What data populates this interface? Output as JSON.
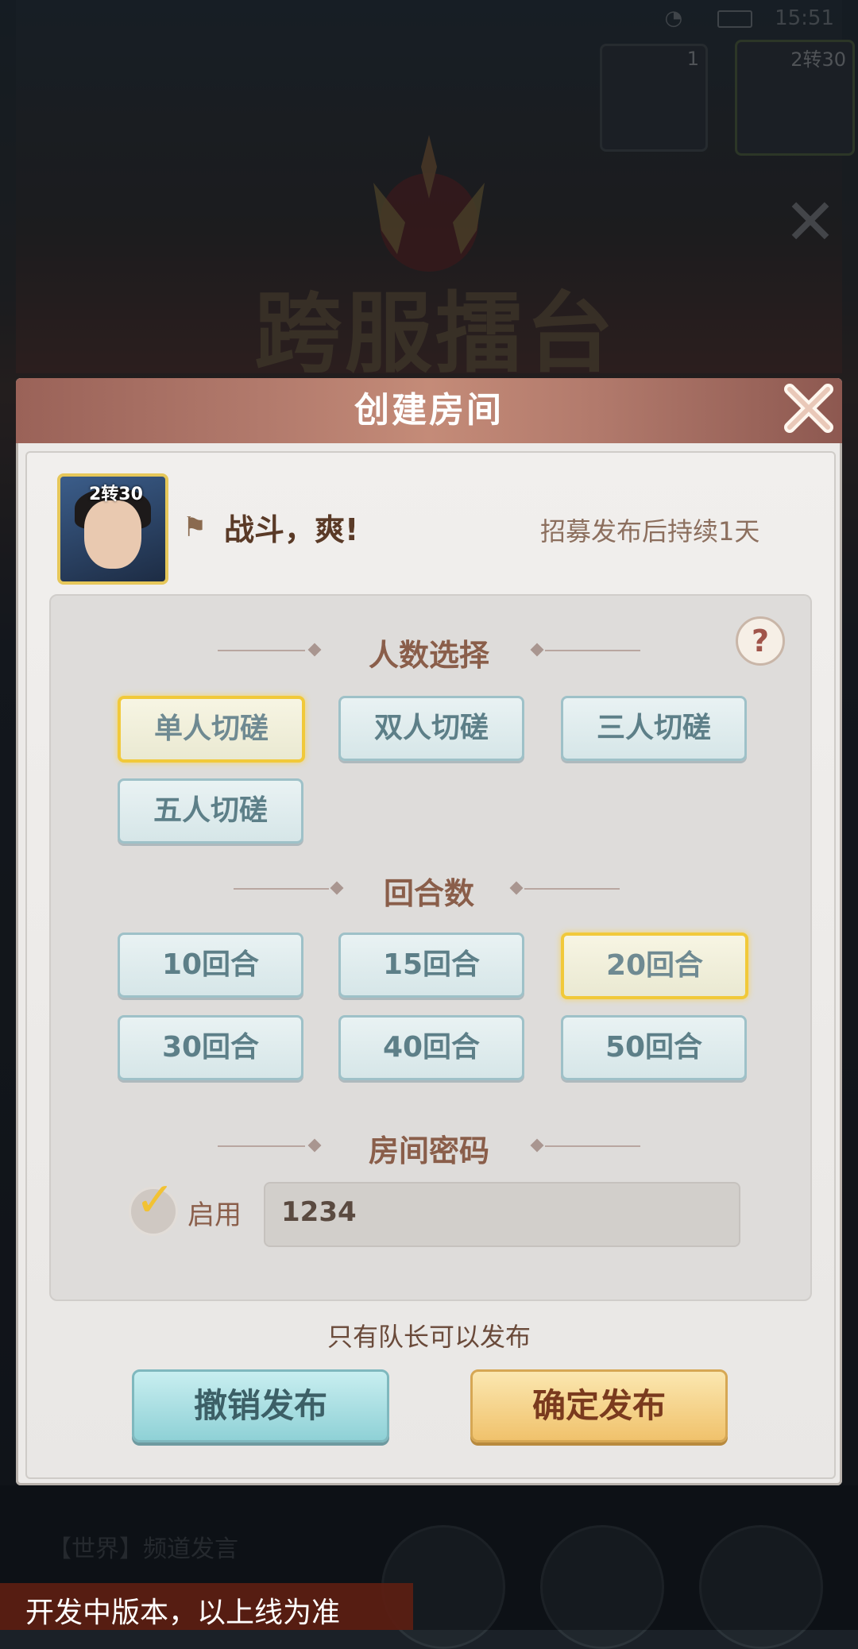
{
  "status_bar": {
    "time": "15:51"
  },
  "background": {
    "title": "跨服擂台",
    "thumb1_count": "1",
    "thumb2_level": "2转30",
    "chat_hint": "【世界】频道发言",
    "dev_banner": "开发中版本，以上线为准"
  },
  "dialog": {
    "title": "创建房间",
    "player": {
      "level": "2转30",
      "motto": "战斗，爽!"
    },
    "duration_text": "招募发布后持续1天",
    "section_players": {
      "title": "人数选择",
      "options": [
        "单人切磋",
        "双人切磋",
        "三人切磋",
        "五人切磋"
      ],
      "selected": "单人切磋"
    },
    "section_rounds": {
      "title": "回合数",
      "options": [
        "10回合",
        "15回合",
        "20回合",
        "30回合",
        "40回合",
        "50回合"
      ],
      "selected": "20回合"
    },
    "section_password": {
      "title": "房间密码",
      "enable_label": "启用",
      "enabled": true,
      "value": "1234"
    },
    "note": "只有队长可以发布",
    "cancel_button": "撤销发布",
    "confirm_button": "确定发布"
  },
  "icons": [
    "close-icon",
    "help-icon",
    "flag-icon",
    "check-icon",
    "signal-icon",
    "battery-icon"
  ],
  "colors": {
    "accent_selected": "#f1c93a",
    "header": "#b27a6c",
    "cancel": "#8fd1d6",
    "confirm": "#f0c26c"
  }
}
